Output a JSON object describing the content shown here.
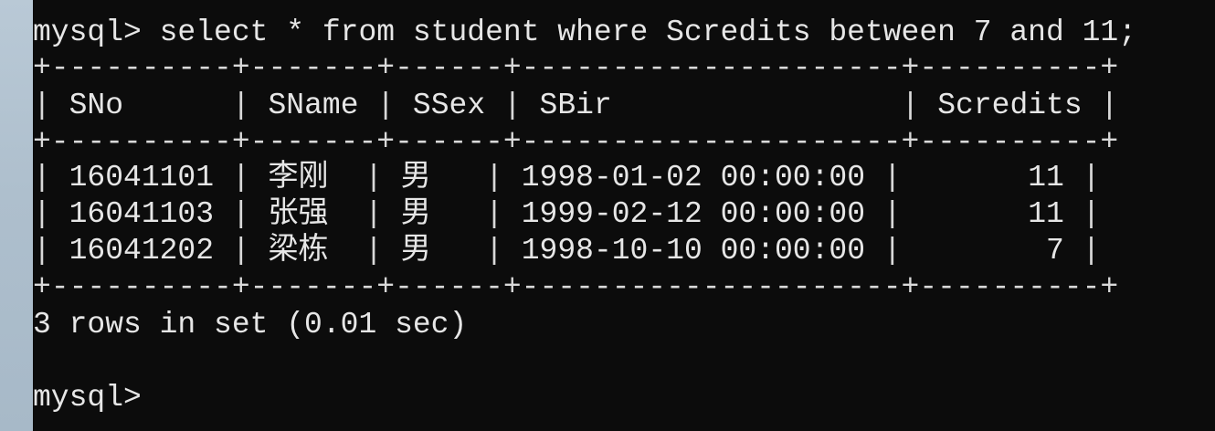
{
  "prompt": "mysql> ",
  "command": "select * from student where Scredits between 7 and 11;",
  "separator": "+----------+-------+------+---------------------+----------+",
  "headers": {
    "sno": "SNo",
    "sname": "SName",
    "ssex": "SSex",
    "sbir": "SBir",
    "scredits": "Scredits"
  },
  "rows": [
    {
      "sno": "16041101",
      "sname": "李刚",
      "ssex": "男",
      "sbir": "1998-01-02 00:00:00",
      "scredits": "11"
    },
    {
      "sno": "16041103",
      "sname": "张强",
      "ssex": "男",
      "sbir": "1999-02-12 00:00:00",
      "scredits": "11"
    },
    {
      "sno": "16041202",
      "sname": "梁栋",
      "ssex": "男",
      "sbir": "1998-10-10 00:00:00",
      "scredits": "7"
    }
  ],
  "result_text": "3 rows in set (0.01 sec)",
  "prompt2": "mysql>"
}
